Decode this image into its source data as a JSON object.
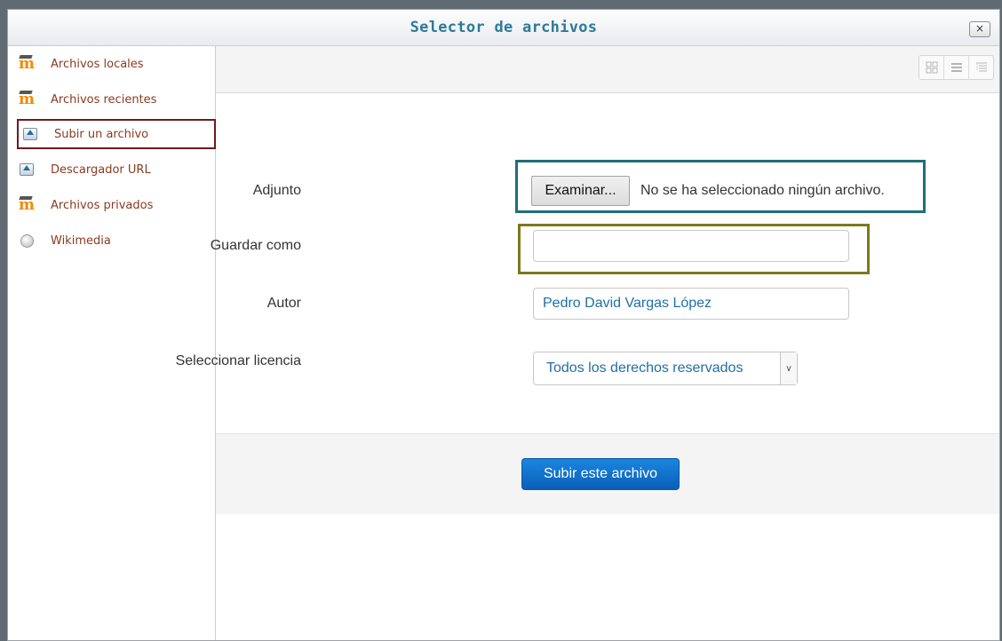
{
  "dialog": {
    "title": "Selector de archivos",
    "close_label": "×"
  },
  "sidebar": {
    "items": [
      {
        "label": "Archivos locales",
        "icon": "moodle-icon"
      },
      {
        "label": "Archivos recientes",
        "icon": "moodle-icon"
      },
      {
        "label": "Subir un archivo",
        "icon": "upload-icon",
        "active": true
      },
      {
        "label": "Descargador URL",
        "icon": "upload-icon"
      },
      {
        "label": "Archivos privados",
        "icon": "moodle-icon"
      },
      {
        "label": "Wikimedia",
        "icon": "wikimedia-icon"
      }
    ]
  },
  "toolbar": {
    "view_buttons": [
      "grid-view-icon",
      "list-view-icon",
      "tree-view-icon"
    ]
  },
  "form": {
    "attachment_label": "Adjunto",
    "browse_button": "Examinar...",
    "no_file_text": "No se ha seleccionado ningún archivo.",
    "save_as_label": "Guardar como",
    "save_as_value": "",
    "author_label": "Autor",
    "author_value": "Pedro David Vargas López",
    "license_label": "Seleccionar licencia",
    "license_value": "Todos los derechos reservados"
  },
  "footer": {
    "submit_label": "Subir este archivo"
  },
  "colors": {
    "title": "#2d7a98",
    "sidebar_link": "#8a3a1f",
    "active_highlight": "#6e1a1e",
    "file_highlight": "#1f6f77",
    "saveas_highlight": "#7b7a1d",
    "submit": "#0a6ad0"
  }
}
